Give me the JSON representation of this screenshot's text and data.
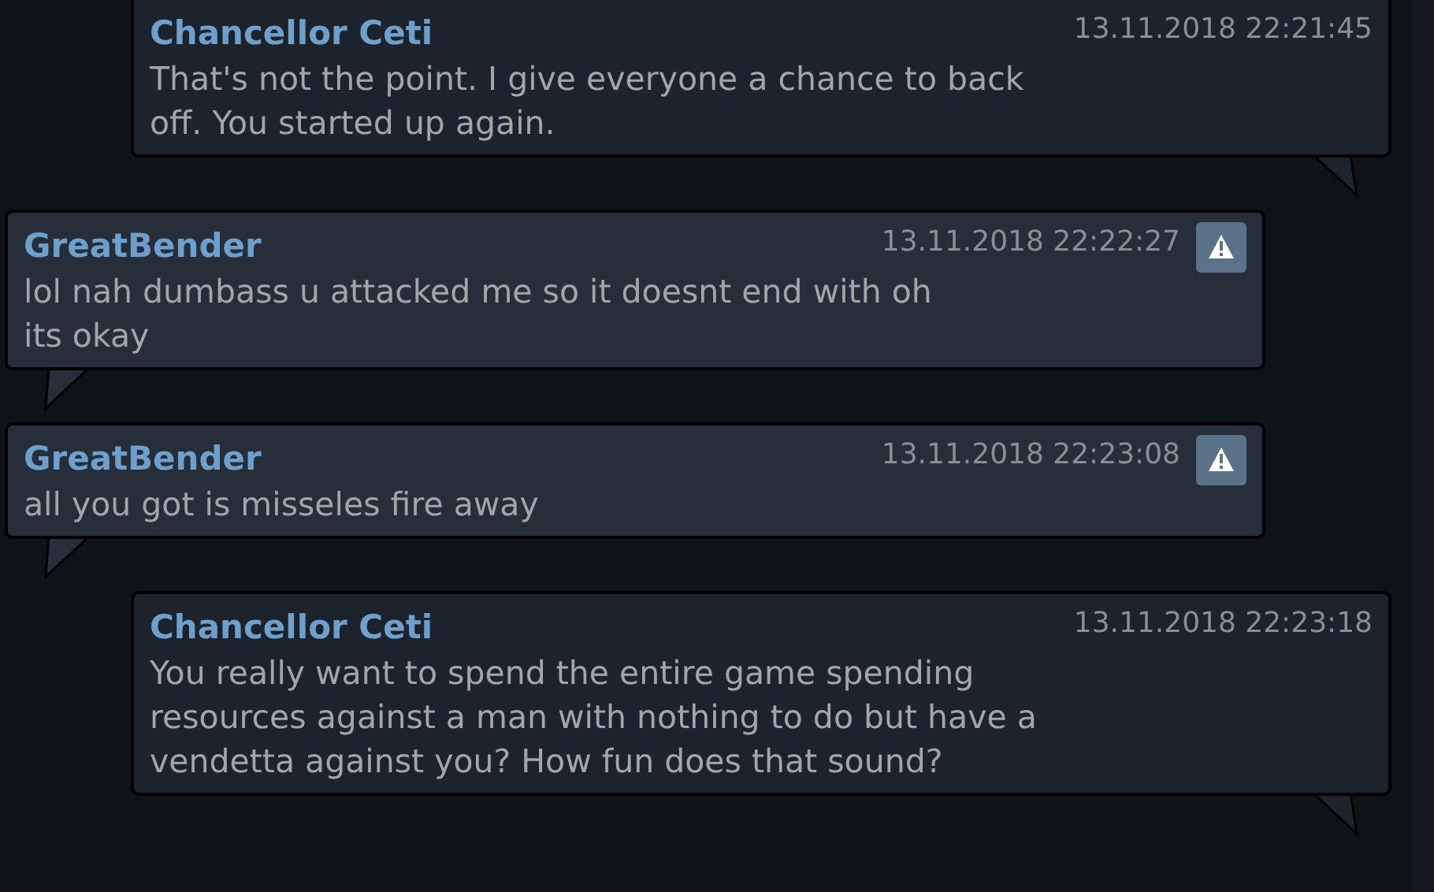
{
  "messages": [
    {
      "kind": "own",
      "author": "Chancellor Ceti",
      "time": "13.11.2018 22:21:45",
      "text": "That's not the point. I give everyone a chance to back off. You started up again.",
      "reportable": false
    },
    {
      "kind": "other",
      "author": "GreatBender",
      "time": "13.11.2018 22:22:27",
      "text": "lol nah dumbass u attacked me so it doesnt end with oh its okay",
      "reportable": true
    },
    {
      "kind": "other",
      "author": "GreatBender",
      "time": "13.11.2018 22:23:08",
      "text": "all you got is misseles fire away",
      "reportable": true
    },
    {
      "kind": "own",
      "author": "Chancellor Ceti",
      "time": "13.11.2018 22:23:18",
      "text": "You really want to spend the entire game spending resources against a man with nothing to do but have a vendetta against you? How fun does that sound?",
      "reportable": false
    }
  ]
}
